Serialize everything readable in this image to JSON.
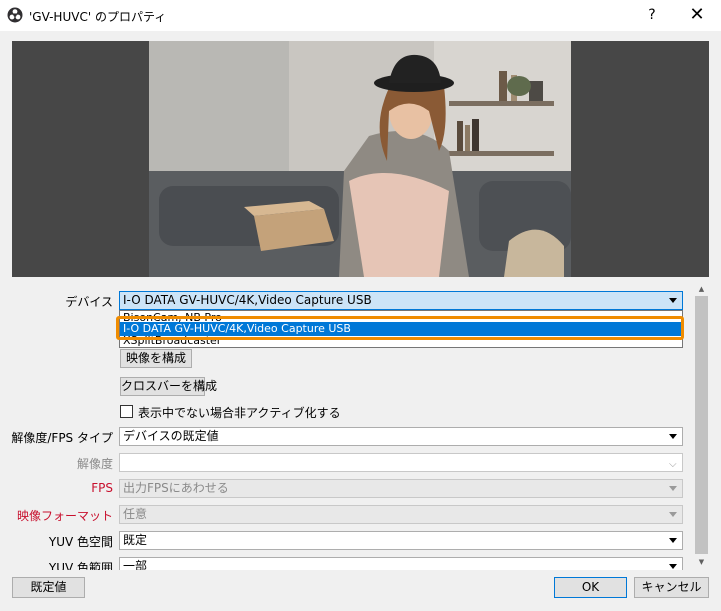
{
  "window": {
    "title": "'GV-HUVC' のプロパティ",
    "help": "?",
    "close": "✕"
  },
  "form": {
    "device": {
      "label": "デバイス",
      "value": "I-O DATA GV-HUVC/4K,Video Capture USB",
      "options": [
        "BisonCam, NB Pro",
        "I-O DATA GV-HUVC/4K,Video Capture USB",
        "XSplitBroadcaster"
      ]
    },
    "configure_video_button": "映像を構成",
    "configure_crossbar_button": "クロスバーを構成",
    "deactivate_checkbox_label": "表示中でない場合非アクティブ化する",
    "res_fps_type": {
      "label": "解像度/FPS タイプ",
      "value": "デバイスの既定値"
    },
    "resolution": {
      "label": "解像度",
      "value": ""
    },
    "fps": {
      "label": "FPS",
      "value": "出力FPSにあわせる"
    },
    "video_format": {
      "label": "映像フォーマット",
      "value": "任意"
    },
    "yuv_color_space": {
      "label": "YUV 色空間",
      "value": "既定"
    },
    "yuv_color_range": {
      "label": "YUV 色範囲",
      "value": "一部"
    }
  },
  "footer": {
    "defaults_button": "既定値",
    "ok_button": "OK",
    "cancel_button": "キャンセル"
  },
  "colors": {
    "selection": "#0078d7",
    "highlight_outline": "#f08c00",
    "preview_bg": "#474747",
    "red_label": "#c8102e"
  }
}
